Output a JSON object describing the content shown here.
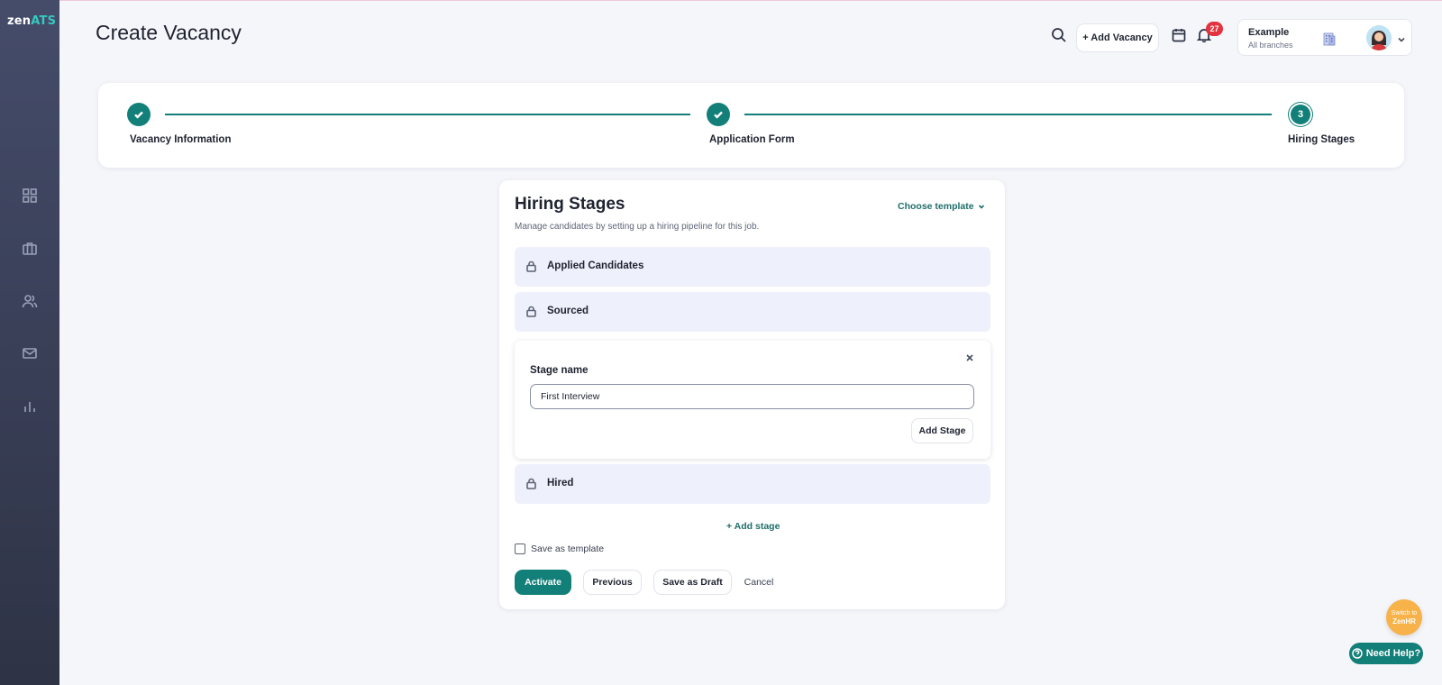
{
  "app": {
    "logo_main": "zen",
    "logo_accent": "ATS"
  },
  "header": {
    "title": "Create Vacancy",
    "add_vacancy_label": "+ Add Vacancy",
    "notifications_count": "27",
    "branch_name": "Example",
    "branch_sub": "All branches"
  },
  "sidebar": {
    "items": [
      {
        "icon": "dashboard-icon"
      },
      {
        "icon": "briefcase-icon"
      },
      {
        "icon": "users-icon"
      },
      {
        "icon": "mail-icon"
      },
      {
        "icon": "bar-chart-icon"
      }
    ]
  },
  "stepper": {
    "steps": [
      {
        "label": "Vacancy Information",
        "state": "done"
      },
      {
        "label": "Application Form",
        "state": "done"
      },
      {
        "label": "Hiring Stages",
        "state": "current",
        "number": "3"
      }
    ]
  },
  "card": {
    "title": "Hiring Stages",
    "subtitle": "Manage candidates by setting up a hiring pipeline for this job.",
    "choose_template_label": "Choose template",
    "stages": [
      {
        "label": "Applied Candidates",
        "locked": true
      },
      {
        "label": "Sourced",
        "locked": true
      },
      {
        "label": "Hired",
        "locked": true
      }
    ],
    "editor": {
      "field_label": "Stage name",
      "field_value": "First Interview",
      "add_button_label": "Add Stage"
    },
    "add_stage_link": "+ Add stage",
    "save_as_template_label": "Save as template",
    "buttons": {
      "activate": "Activate",
      "previous": "Previous",
      "save_draft": "Save as Draft",
      "cancel": "Cancel"
    }
  },
  "floating": {
    "switch_line1": "Switch to",
    "switch_line2": "ZenHR",
    "need_help": "Need Help?"
  },
  "colors": {
    "primary": "#127f78",
    "sidebar_top": "#454c6a",
    "sidebar_bottom": "#2e3345",
    "badge": "#e2333f",
    "stage_bg": "#eef1fb",
    "switch_bg": "#f7b24a"
  }
}
